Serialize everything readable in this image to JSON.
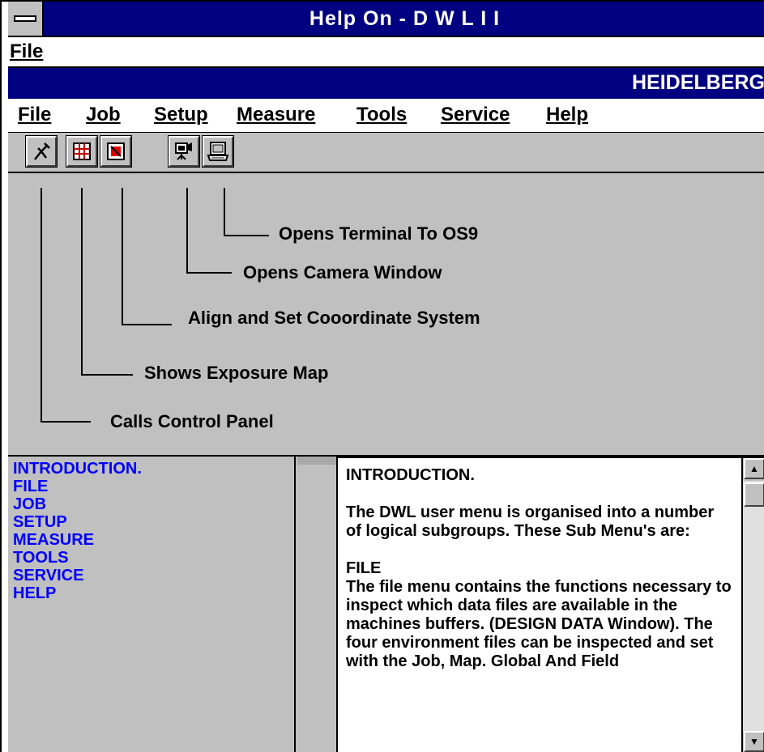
{
  "window": {
    "title": "Help On - D W L I I"
  },
  "outer_menu": {
    "file_label": "File"
  },
  "banner": {
    "text": "HEIDELBERG"
  },
  "app_menu": {
    "items": [
      {
        "label": "File"
      },
      {
        "label": "Job"
      },
      {
        "label": "Setup"
      },
      {
        "label": "Measure"
      },
      {
        "label": "Tools"
      },
      {
        "label": "Service"
      },
      {
        "label": "Help"
      }
    ]
  },
  "toolbar": {
    "buttons": [
      {
        "icon": "control-panel-icon"
      },
      {
        "icon": "exposure-map-icon"
      },
      {
        "icon": "align-coordinate-icon"
      },
      {
        "icon": "camera-icon"
      },
      {
        "icon": "terminal-icon"
      }
    ]
  },
  "diagram": {
    "labels": {
      "terminal": "Opens Terminal To OS9",
      "camera": "Opens Camera Window",
      "align": "Align and Set Cooordinate System",
      "exposure": "Shows Exposure Map",
      "control": "Calls Control Panel"
    }
  },
  "contents": {
    "items": [
      "INTRODUCTION.",
      "FILE",
      "JOB",
      "SETUP",
      "MEASURE",
      "TOOLS",
      "SERVICE",
      "HELP"
    ]
  },
  "help_text": {
    "heading": "INTRODUCTION.",
    "para1": "The DWL user menu is organised into a number of logical subgroups. These Sub Menu's are:",
    "section": "FILE",
    "para2": "The file menu contains the functions necessary to inspect which data files are available in the machines buffers. (DESIGN DATA Window). The four environment files can be inspected and set with the Job, Map. Global And Field"
  },
  "colors": {
    "titlebar": "#000080",
    "link": "#0000ff",
    "face": "#c0c0c0"
  }
}
